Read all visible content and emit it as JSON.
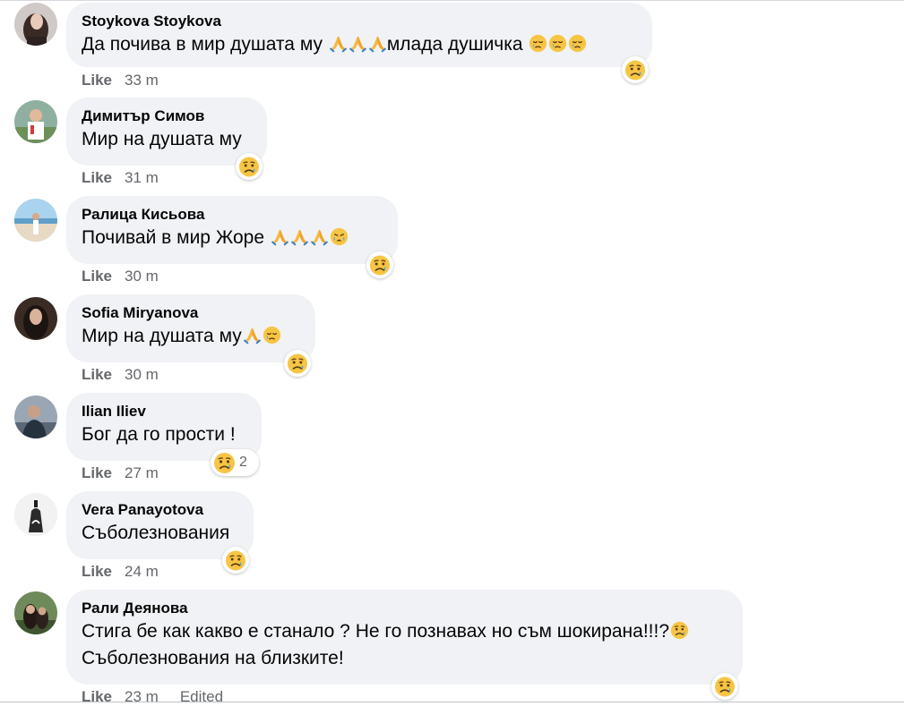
{
  "comments": [
    {
      "author": "Stoykova Stoykova",
      "text_parts": [
        "Да почива в мир душата му ",
        "младa душичка "
      ],
      "text_a": "Да почива в мир душата му ",
      "text_b": "млада душичка ",
      "like": "Like",
      "time": "33 m"
    },
    {
      "author": "Димитър Симов",
      "text": "Мир на душата му",
      "like": "Like",
      "time": "31 m"
    },
    {
      "author": "Ралица Кисьова",
      "text": "Почивай в мир Жоре ",
      "like": "Like",
      "time": "30 m"
    },
    {
      "author": "Sofia Miryanova",
      "text": "Мир на душата му",
      "like": "Like",
      "time": "30 m"
    },
    {
      "author": "Ilian Iliev",
      "text": "Бог да го прости !",
      "like": "Like",
      "time": "27 m",
      "reaction_count": "2"
    },
    {
      "author": "Vera Panayotova",
      "text": "Съболезнования",
      "like": "Like",
      "time": "24 m"
    },
    {
      "author": "Рали Деянова",
      "text_line1": "Стига бе как какво е станало ? Не го познавах но съм шокирана!!!?",
      "text_line2": "Съболезнования на близките!",
      "like": "Like",
      "time": "23 m",
      "edited": "Edited"
    }
  ],
  "reaction_type": "sad-reaction",
  "colors": {
    "bubble": "#f0f2f5",
    "meta": "#65676b",
    "text": "#050505",
    "emoji_yellow": "#f7c545"
  }
}
